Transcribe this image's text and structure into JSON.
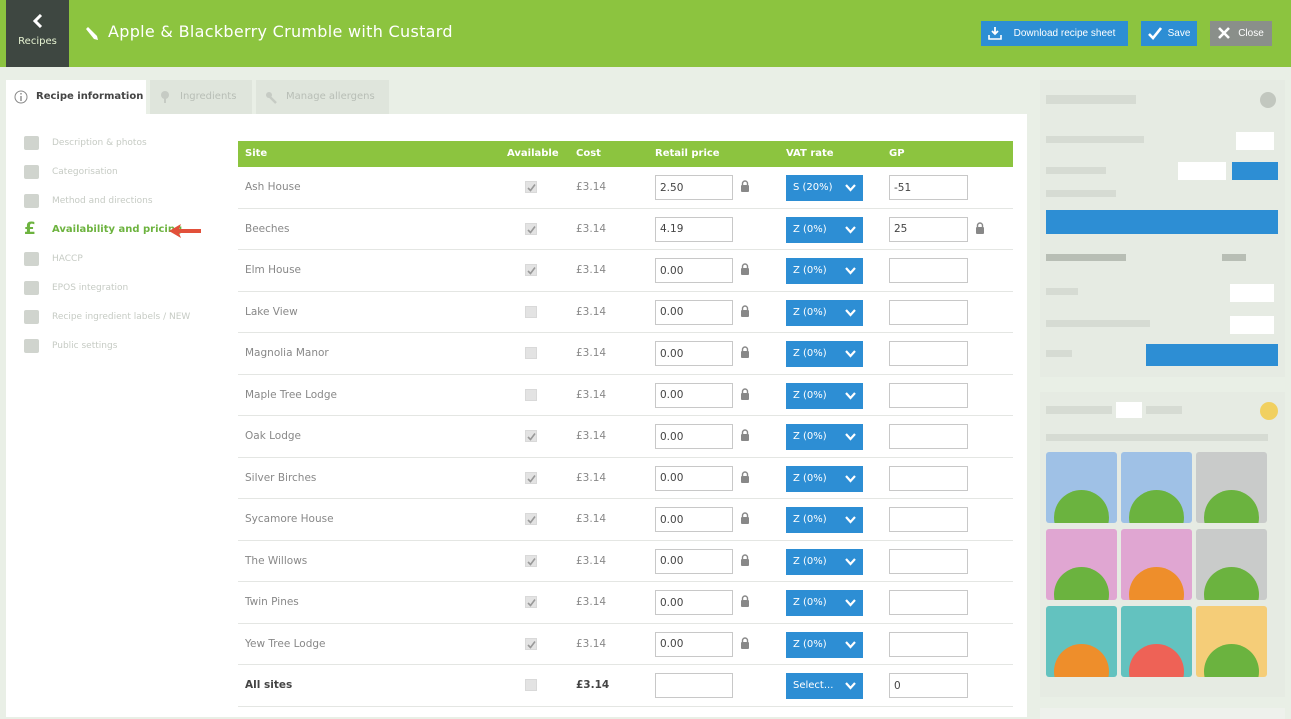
{
  "header": {
    "back_label": "Recipes",
    "title": "Apple & Blackberry Crumble with Custard",
    "download_label": "Download recipe sheet",
    "save_label": "Save",
    "close_label": "Close",
    "colors": {
      "bar": "#8cc43f",
      "button": "#2d8ed4",
      "close": "#8a8f8a"
    }
  },
  "tabs": {
    "recipe_info": "Recipe information",
    "ingredients": "Ingredients",
    "allergens": "Manage allergens"
  },
  "sidebar": {
    "items": [
      {
        "label": "Description & photos",
        "icon": "image-icon"
      },
      {
        "label": "Categorisation",
        "icon": "tag-icon"
      },
      {
        "label": "Method and directions",
        "icon": "document-icon"
      },
      {
        "label": "Availability and pricing",
        "icon": "pound-icon"
      },
      {
        "label": "HACCP",
        "icon": "warning-icon"
      },
      {
        "label": "EPOS integration",
        "icon": "till-icon"
      },
      {
        "label": "Recipe ingredient labels / NEW",
        "icon": "label-icon"
      },
      {
        "label": "Public settings",
        "icon": "megaphone-icon"
      }
    ]
  },
  "table": {
    "headers": {
      "site": "Site",
      "available": "Available",
      "cost": "Cost",
      "retail": "Retail price",
      "vat": "VAT rate",
      "gp": "GP"
    },
    "rows": [
      {
        "site": "Ash House",
        "available": true,
        "cost": "£3.14",
        "retail": "2.50",
        "vat": "S (20%)",
        "gp": "-51"
      },
      {
        "site": "Beeches",
        "available": true,
        "cost": "£3.14",
        "retail": "4.19",
        "vat": "Z (0%)",
        "gp": "25"
      },
      {
        "site": "Elm House",
        "available": true,
        "cost": "£3.14",
        "retail": "0.00",
        "vat": "Z (0%)",
        "gp": ""
      },
      {
        "site": "Lake View",
        "available": false,
        "cost": "£3.14",
        "retail": "0.00",
        "vat": "Z (0%)",
        "gp": ""
      },
      {
        "site": "Magnolia Manor",
        "available": false,
        "cost": "£3.14",
        "retail": "0.00",
        "vat": "Z (0%)",
        "gp": ""
      },
      {
        "site": "Maple Tree Lodge",
        "available": false,
        "cost": "£3.14",
        "retail": "0.00",
        "vat": "Z (0%)",
        "gp": ""
      },
      {
        "site": "Oak Lodge",
        "available": true,
        "cost": "£3.14",
        "retail": "0.00",
        "vat": "Z (0%)",
        "gp": ""
      },
      {
        "site": "Silver Birches",
        "available": true,
        "cost": "£3.14",
        "retail": "0.00",
        "vat": "Z (0%)",
        "gp": ""
      },
      {
        "site": "Sycamore House",
        "available": true,
        "cost": "£3.14",
        "retail": "0.00",
        "vat": "Z (0%)",
        "gp": ""
      },
      {
        "site": "The Willows",
        "available": true,
        "cost": "£3.14",
        "retail": "0.00",
        "vat": "Z (0%)",
        "gp": ""
      },
      {
        "site": "Twin Pines",
        "available": true,
        "cost": "£3.14",
        "retail": "0.00",
        "vat": "Z (0%)",
        "gp": ""
      },
      {
        "site": "Yew Tree Lodge",
        "available": true,
        "cost": "£3.14",
        "retail": "0.00",
        "vat": "Z (0%)",
        "gp": ""
      }
    ],
    "total": {
      "site": "All sites",
      "available": false,
      "cost": "£3.14",
      "retail": "",
      "vat": "Select...",
      "gp": "0"
    }
  }
}
